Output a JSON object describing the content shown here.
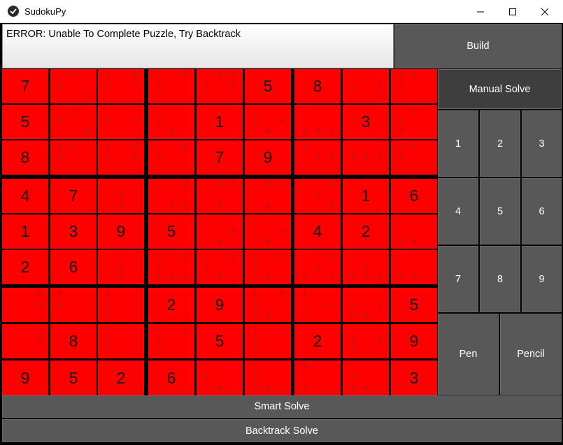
{
  "window": {
    "title": "SudokuPy",
    "icons": {
      "app": "app-icon",
      "minimize": "minimize-icon",
      "maximize": "maximize-icon",
      "close": "close-icon"
    }
  },
  "status": {
    "message": "ERROR: Unable To Complete Puzzle, Try Backtrack"
  },
  "buttons": {
    "build": "Build",
    "manual_solve": "Manual Solve",
    "pen": "Pen",
    "pencil": "Pencil",
    "smart_solve": "Smart Solve",
    "backtrack_solve": "Backtrack Solve"
  },
  "keypad": [
    "1",
    "2",
    "3",
    "4",
    "5",
    "6",
    "7",
    "8",
    "9"
  ],
  "colors": {
    "cell": "#ff0000",
    "button": "#585858",
    "button_dark": "#3e3e3e",
    "grid_lines": "#000000"
  },
  "board": [
    [
      {
        "v": "7"
      },
      {
        "c": [
          "2",
          "4",
          "9"
        ]
      },
      {
        "c": [
          "1",
          "3",
          "4",
          "6"
        ]
      },
      {
        "c": [
          "3",
          "4"
        ]
      },
      {
        "c": [
          "2",
          "3",
          "4",
          "6"
        ]
      },
      {
        "v": "5"
      },
      {
        "v": "8"
      },
      {
        "c": [
          "4",
          "6",
          "9"
        ]
      },
      {
        "c": [
          "1",
          "2",
          "4"
        ]
      }
    ],
    [
      {
        "v": "5"
      },
      {
        "c": [
          "2",
          "4",
          "9"
        ]
      },
      {
        "c": [
          "4",
          "6"
        ]
      },
      {
        "c": [
          "4",
          "8"
        ]
      },
      {
        "v": "1"
      },
      {
        "c": [
          "4",
          "6",
          "8"
        ]
      },
      {
        "c": [
          "7",
          "8",
          "9"
        ]
      },
      {
        "v": "3"
      },
      {
        "c": [
          "2",
          "4",
          "7"
        ]
      }
    ],
    [
      {
        "v": "8"
      },
      {
        "c": [
          "1",
          "2",
          "4"
        ]
      },
      {
        "c": [
          "1",
          "3",
          "4",
          "6"
        ]
      },
      {
        "c": [
          "3",
          "4"
        ]
      },
      {
        "v": "7"
      },
      {
        "v": "9"
      },
      {
        "c": [
          "1",
          "5",
          "6"
        ]
      },
      {
        "c": [
          "4",
          "5",
          "6"
        ]
      },
      {
        "c": [
          "1",
          "2",
          "4"
        ]
      }
    ],
    [
      {
        "v": "4"
      },
      {
        "v": "7"
      },
      {
        "c": [
          "5",
          "8"
        ]
      },
      {
        "c": [
          "3",
          "8",
          "9"
        ]
      },
      {
        "c": [
          "2",
          "3",
          "8"
        ]
      },
      {
        "c": [
          "2",
          "3",
          "8"
        ]
      },
      {
        "c": [
          "3",
          "5",
          "9"
        ]
      },
      {
        "v": "1"
      },
      {
        "v": "6"
      }
    ],
    [
      {
        "v": "1"
      },
      {
        "v": "3"
      },
      {
        "v": "9"
      },
      {
        "v": "5"
      },
      {
        "c": [
          "6",
          "8"
        ]
      },
      {
        "c": [
          "6",
          "7",
          "8"
        ]
      },
      {
        "v": "4"
      },
      {
        "v": "2"
      },
      {
        "c": [
          "7",
          "8"
        ]
      }
    ],
    [
      {
        "v": "2"
      },
      {
        "v": "6"
      },
      {
        "c": [
          "5",
          "8"
        ]
      },
      {
        "c": [
          "1",
          "3",
          "4",
          "7",
          "8",
          "9"
        ]
      },
      {
        "c": [
          "3",
          "4",
          "8"
        ]
      },
      {
        "c": [
          "1",
          "3",
          "4",
          "7",
          "8"
        ]
      },
      {
        "c": [
          "3",
          "5",
          "7",
          "9"
        ]
      },
      {
        "c": [
          "5",
          "7",
          "8",
          "9"
        ]
      },
      {
        "c": [
          "7",
          "8"
        ]
      }
    ],
    [
      {
        "c": [
          "3",
          "6"
        ]
      },
      {
        "c": [
          "1",
          "4"
        ]
      },
      {
        "c": [
          "1",
          "4",
          "7"
        ]
      },
      {
        "v": "2"
      },
      {
        "v": "9"
      },
      {
        "c": [
          "1",
          "3",
          "4",
          "7",
          "8"
        ]
      },
      {
        "c": [
          "1",
          "6",
          "7"
        ]
      },
      {
        "c": [
          "4",
          "6",
          "7",
          "8"
        ]
      },
      {
        "v": "5"
      }
    ],
    [
      {
        "c": [
          "3",
          "6"
        ]
      },
      {
        "v": "8"
      },
      {
        "c": [
          "1",
          "4",
          "7"
        ]
      },
      {
        "c": [
          "1",
          "3",
          "4",
          "7"
        ]
      },
      {
        "v": "5"
      },
      {
        "c": [
          "1",
          "3",
          "4",
          "7"
        ]
      },
      {
        "v": "2"
      },
      {
        "c": [
          "4",
          "6",
          "7"
        ]
      },
      {
        "v": "9"
      }
    ],
    [
      {
        "v": "9"
      },
      {
        "v": "5"
      },
      {
        "v": "2"
      },
      {
        "v": "6"
      },
      {
        "c": [
          "4",
          "8"
        ]
      },
      {
        "c": [
          "1",
          "4",
          "7",
          "8"
        ]
      },
      {
        "c": [
          "1",
          "7"
        ]
      },
      {
        "c": [
          "4",
          "7",
          "8"
        ]
      },
      {
        "v": "3"
      }
    ]
  ]
}
